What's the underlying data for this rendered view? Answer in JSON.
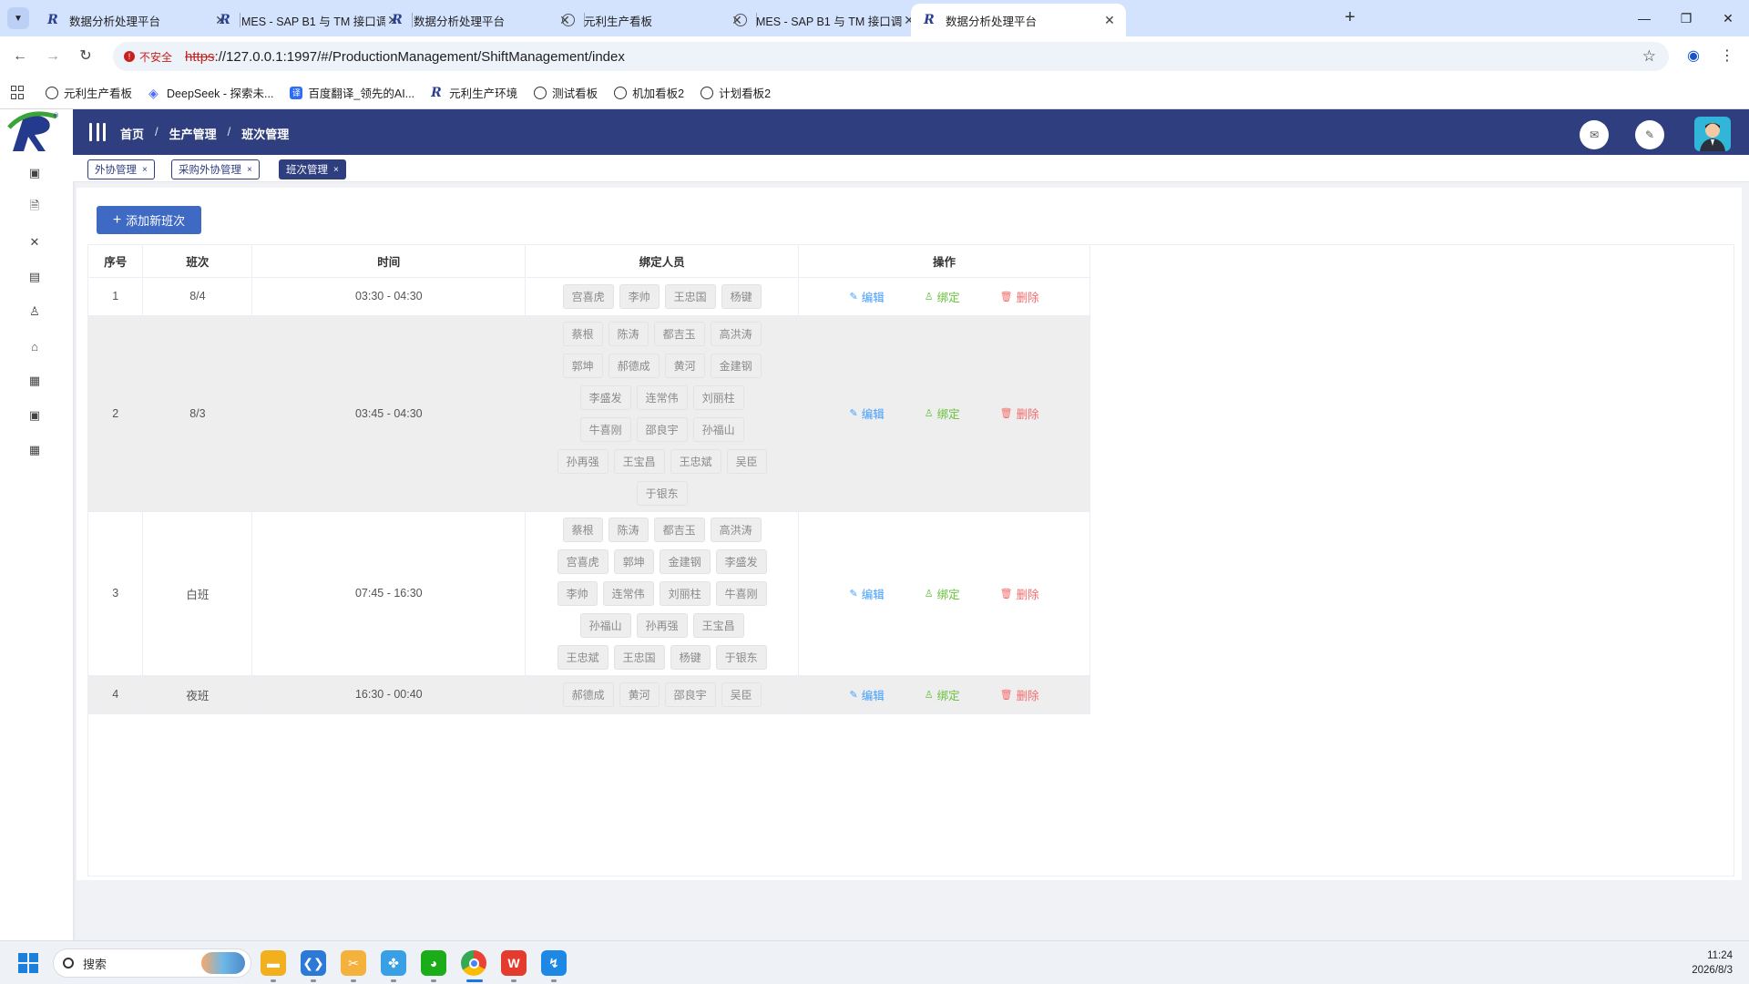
{
  "browser": {
    "tabs": [
      {
        "title": "数据分析处理平台",
        "icon": "r-logo",
        "active": false
      },
      {
        "title": "MES - SAP B1 与 TM 接口调用",
        "icon": "r-logo",
        "active": false
      },
      {
        "title": "数据分析处理平台",
        "icon": "r-logo",
        "active": false
      },
      {
        "title": "元利生产看板",
        "icon": "globe",
        "active": false
      },
      {
        "title": "MES - SAP B1 与 TM 接口调用",
        "icon": "globe",
        "active": false
      },
      {
        "title": "数据分析处理平台",
        "icon": "r-logo",
        "active": true
      }
    ],
    "security_label": "不安全",
    "url_scheme": "https",
    "url_rest": "://127.0.0.1:1997/#/ProductionManagement/ShiftManagement/index",
    "bookmarks": [
      {
        "label": "元利生产看板",
        "icon": "globe"
      },
      {
        "label": "DeepSeek - 探索未...",
        "icon": "deepseek"
      },
      {
        "label": "百度翻译_领先的AI...",
        "icon": "baidu-translate"
      },
      {
        "label": "元利生产环境",
        "icon": "r-logo"
      },
      {
        "label": "测试看板",
        "icon": "globe"
      },
      {
        "label": "机加看板2",
        "icon": "globe"
      },
      {
        "label": "计划看板2",
        "icon": "globe"
      }
    ]
  },
  "app": {
    "breadcrumb": [
      "首页",
      "生产管理",
      "班次管理"
    ],
    "tags": [
      {
        "label": "外协管理",
        "active": false
      },
      {
        "label": "采购外协管理",
        "active": false
      },
      {
        "label": "班次管理",
        "active": true
      }
    ],
    "add_button_label": "添加新班次",
    "columns": [
      "序号",
      "班次",
      "时间",
      "绑定人员",
      "操作"
    ],
    "actions": {
      "edit": "编辑",
      "bind": "绑定",
      "delete": "删除"
    },
    "rows": [
      {
        "index": "1",
        "shift": "8/4",
        "time": "03:30 - 04:30",
        "people": [
          "宫喜虎",
          "李帅",
          "王忠国",
          "杨键"
        ]
      },
      {
        "index": "2",
        "shift": "8/3",
        "time": "03:45 - 04:30",
        "people": [
          "蔡根",
          "陈涛",
          "都吉玉",
          "高洪涛",
          "郭坤",
          "郝德成",
          "黄河",
          "金建钢",
          "李盛发",
          "连常伟",
          "刘丽柱",
          "牛喜刚",
          "邵良宇",
          "孙福山",
          "孙再强",
          "王宝昌",
          "王忠斌",
          "吴臣",
          "于银东"
        ]
      },
      {
        "index": "3",
        "shift": "白班",
        "time": "07:45 - 16:30",
        "people": [
          "蔡根",
          "陈涛",
          "都吉玉",
          "高洪涛",
          "宫喜虎",
          "郭坤",
          "金建钢",
          "李盛发",
          "李帅",
          "连常伟",
          "刘丽柱",
          "牛喜刚",
          "孙福山",
          "孙再强",
          "王宝昌",
          "王忠斌",
          "王忠国",
          "杨键",
          "于银东"
        ]
      },
      {
        "index": "4",
        "shift": "夜班",
        "time": "16:30 - 00:40",
        "people": [
          "郝德成",
          "黄河",
          "邵良宇",
          "吴臣"
        ]
      }
    ]
  },
  "taskbar": {
    "search_placeholder": "搜索",
    "time": "11:24",
    "date": "2026/8/3"
  },
  "colors": {
    "brand_nav": "#2f3e7e",
    "primary_button": "#3f6ac4",
    "edit": "#409eff",
    "bind": "#67c23a",
    "delete": "#f56c6c"
  }
}
